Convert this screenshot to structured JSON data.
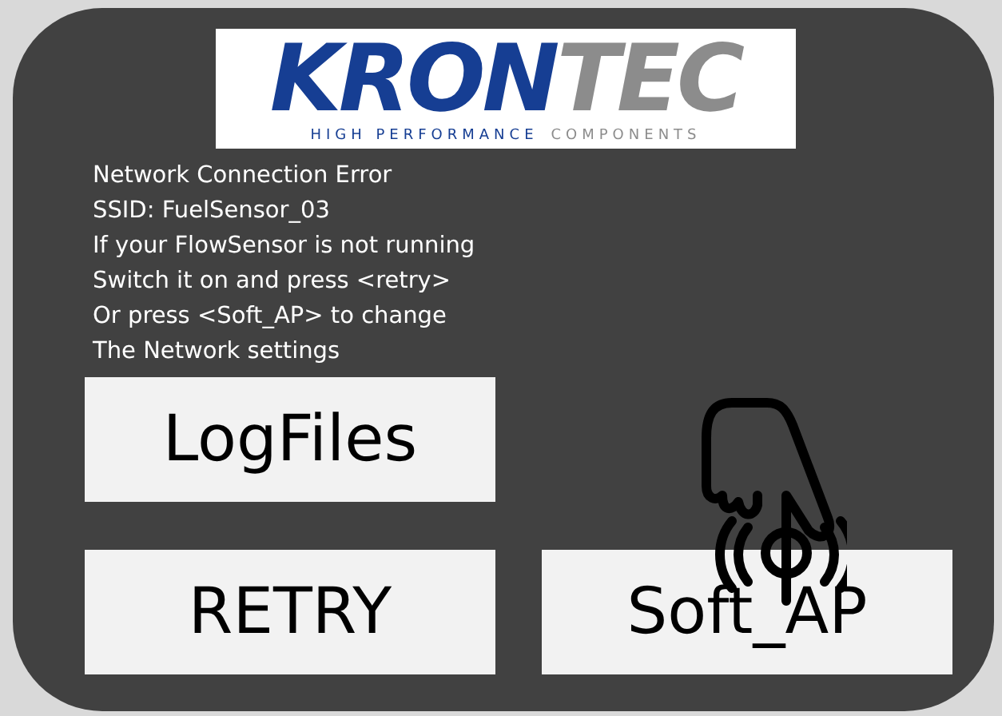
{
  "logo": {
    "brand": [
      "KRON",
      "TEC"
    ],
    "tagline": [
      "HIGH PERFORMANCE",
      "COMPONENTS"
    ]
  },
  "message_lines": [
    "Network Connection Error",
    "SSID: FuelSensor_03",
    "If your FlowSensor is not running",
    "Switch it on and press <retry>",
    "Or press <Soft_AP> to change",
    "The Network settings"
  ],
  "buttons": [
    {
      "label": "LogFiles"
    },
    {
      "label": "RETRY"
    },
    {
      "label": "Soft_AP"
    }
  ]
}
